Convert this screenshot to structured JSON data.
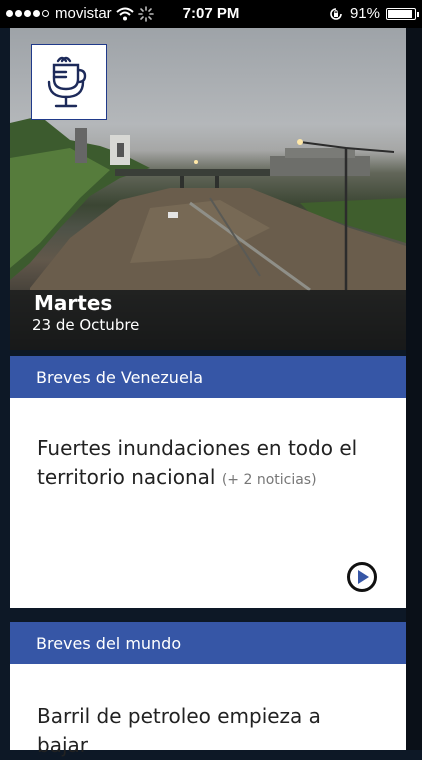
{
  "status_bar": {
    "carrier": "movistar",
    "time": "7:07 PM",
    "battery_percent": "91%",
    "battery_level": 0.91,
    "icons": [
      "signal-dots-icon",
      "wifi-icon",
      "loading-spinner-icon",
      "rotation-lock-icon",
      "battery-icon"
    ]
  },
  "hero": {
    "day": "Martes",
    "date": "23 de Octubre",
    "logo_icon": "microphone-cup-logo-icon",
    "image_description_icon": "flooded-highway-photo"
  },
  "cards": [
    {
      "header": "Breves de Venezuela",
      "title": "Fuertes inundaciones en todo el territorio nacional",
      "more": "(+ 2 noticias)",
      "action_icon": "play-icon"
    },
    {
      "header": "Breves del mundo",
      "title": "Barril de petroleo empieza a bajar"
    }
  ],
  "colors": {
    "accent": "#3656a6",
    "background": "#0d1826"
  }
}
